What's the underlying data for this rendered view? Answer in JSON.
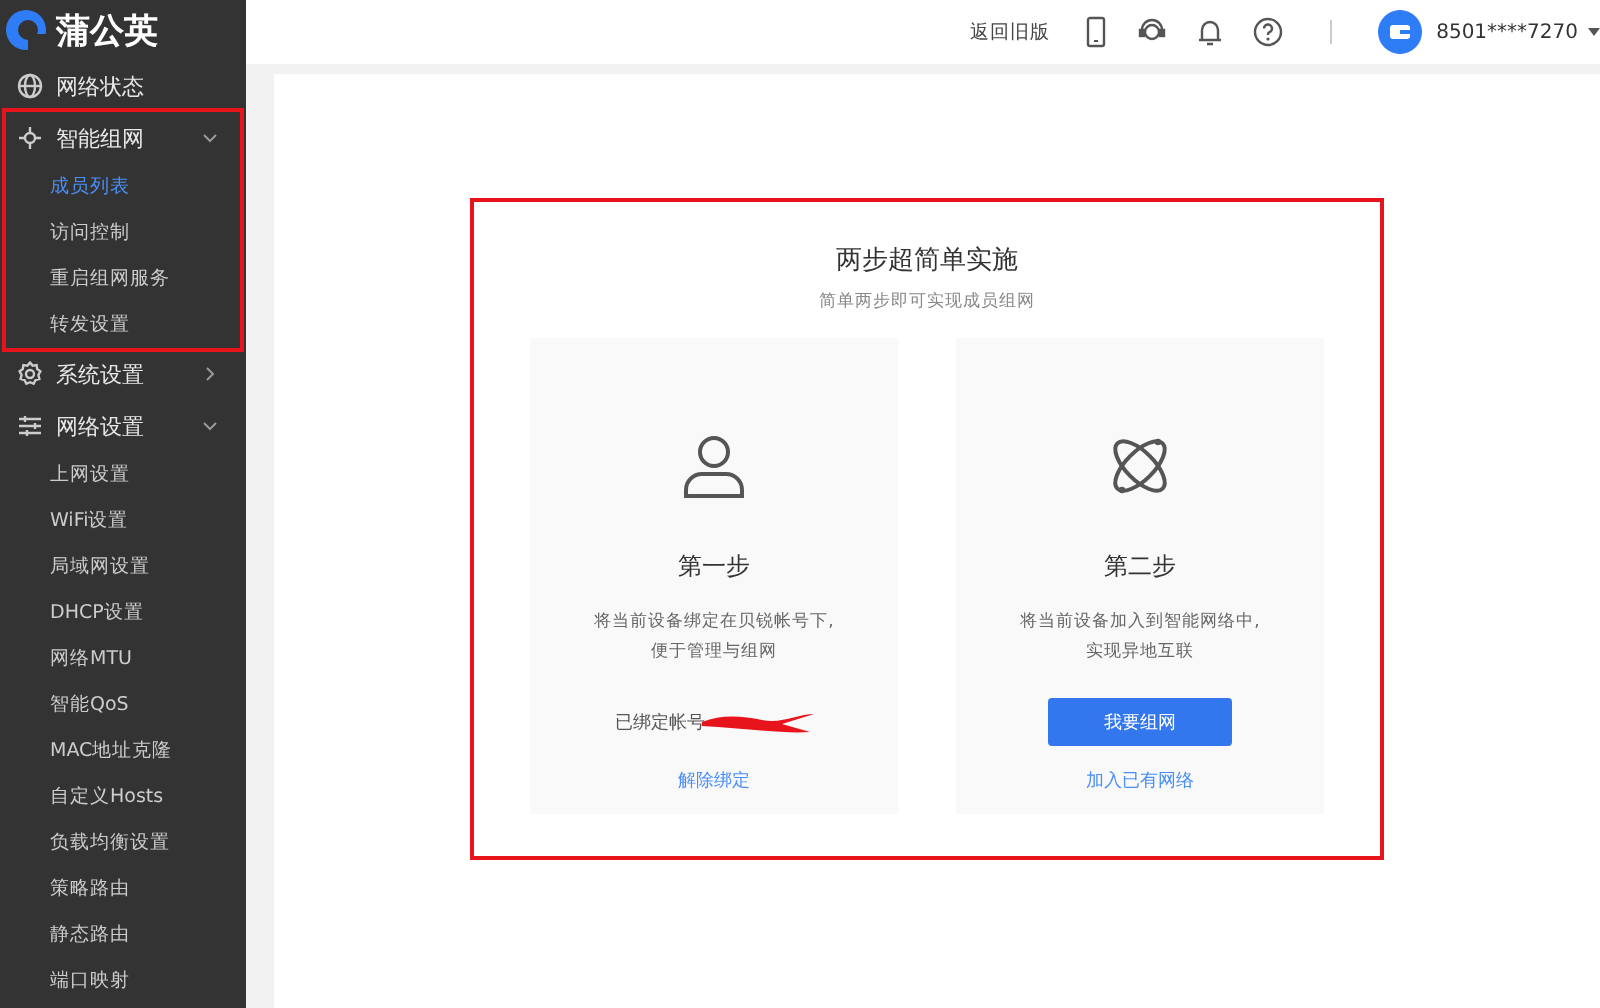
{
  "logo": {
    "text": "蒲公英"
  },
  "sidebar": {
    "items": [
      {
        "label": "网络状态",
        "highlighted": false
      },
      {
        "label": "智能组网",
        "expanded": true,
        "highlighted": true,
        "children": [
          {
            "label": "成员列表",
            "selected": true
          },
          {
            "label": "访问控制",
            "selected": false
          },
          {
            "label": "重启组网服务",
            "selected": false
          },
          {
            "label": "转发设置",
            "selected": false
          }
        ]
      },
      {
        "label": "系统设置",
        "expanded": false,
        "highlighted": false
      },
      {
        "label": "网络设置",
        "expanded": true,
        "highlighted": false,
        "children": [
          {
            "label": "上网设置",
            "selected": false
          },
          {
            "label": "WiFi设置",
            "selected": false
          },
          {
            "label": "局域网设置",
            "selected": false
          },
          {
            "label": "DHCP设置",
            "selected": false
          },
          {
            "label": "网络MTU",
            "selected": false
          },
          {
            "label": "智能QoS",
            "selected": false
          },
          {
            "label": "MAC地址克隆",
            "selected": false
          },
          {
            "label": "自定义Hosts",
            "selected": false
          },
          {
            "label": "负载均衡设置",
            "selected": false
          },
          {
            "label": "策略路由",
            "selected": false
          },
          {
            "label": "静态路由",
            "selected": false
          },
          {
            "label": "端口映射",
            "selected": false
          }
        ]
      }
    ]
  },
  "topbar": {
    "back_link": "返回旧版",
    "account": "8501****7270"
  },
  "steps_panel": {
    "title": "两步超简单实施",
    "subtitle": "简单两步即可实现成员组网",
    "highlighted": true,
    "steps": [
      {
        "kind": "bind",
        "title": "第一步",
        "lines": [
          "将当前设备绑定在贝锐帐号下,",
          "便于管理与组网"
        ],
        "bound_label": "已绑定帐号",
        "redacted": true,
        "link": "解除绑定"
      },
      {
        "kind": "join",
        "title": "第二步",
        "lines": [
          "将当前设备加入到智能网络中,",
          "实现异地互联"
        ],
        "button": "我要组网",
        "link": "加入已有网络"
      }
    ]
  }
}
